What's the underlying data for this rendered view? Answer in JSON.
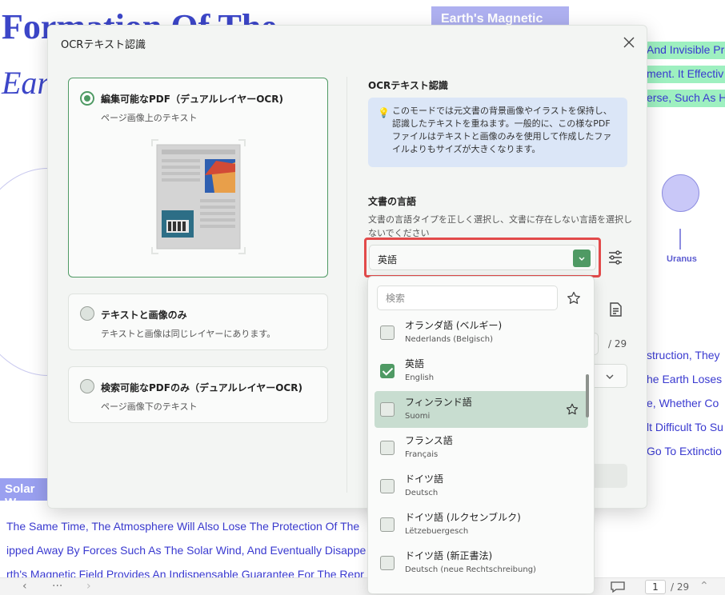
{
  "background": {
    "title_line1": "Formation Of The",
    "title_line2": "Earth",
    "tag": "Earth's Magnetic",
    "highlight_lines": [
      "And Invisible Pro",
      "ment. It Effectiv",
      "erse, Such As H"
    ],
    "right_lines": [
      "struction, They",
      "he Earth Loses",
      "e, Whether Co",
      "lt Difficult To Su",
      "Go To Extinctio"
    ],
    "planet_label": "Uranus",
    "solar_tag": "Solar W",
    "bottom_lines": [
      "The Same Time, The Atmosphere Will Also Lose The Protection Of The",
      "ipped Away By Forces Such As The Solar Wind, And Eventually Disappe",
      "rth's Magnetic Field Provides An Indispensable Guarantee For The Repr"
    ],
    "page_current": "1",
    "page_total": "/ 29"
  },
  "dialog": {
    "title": "OCRテキスト認識",
    "options": [
      {
        "title": "編集可能なPDF（デュアルレイヤーOCR)",
        "subtitle": "ページ画像上のテキスト",
        "selected": true
      },
      {
        "title": "テキストと画像のみ",
        "subtitle": "テキストと画像は同じレイヤーにあります。",
        "selected": false
      },
      {
        "title": "検索可能なPDFのみ（デュアルレイヤーOCR)",
        "subtitle": "ページ画像下のテキスト",
        "selected": false
      }
    ],
    "section_title": "OCRテキスト認識",
    "info_text": "このモードでは元文書の背景画像やイラストを保持し、認識したテキストを重ねます。一般的に、この様なPDFファイルはテキストと画像のみを使用して作成したファイルよりもサイズが大きくなります。",
    "language_heading": "文書の言語",
    "language_desc": "文書の言語タイプを正しく選択し、文書に存在しない言語を選択しないでください",
    "selected_language": "英語",
    "page_total": "/ 29"
  },
  "dropdown": {
    "search_placeholder": "検索",
    "items": [
      {
        "name": "オランダ語 (ベルギー)",
        "native": "Nederlands (Belgisch)",
        "checked": false,
        "hover": false
      },
      {
        "name": "英語",
        "native": "English",
        "checked": true,
        "hover": false
      },
      {
        "name": "フィンランド語",
        "native": "Suomi",
        "checked": false,
        "hover": true
      },
      {
        "name": "フランス語",
        "native": "Français",
        "checked": false,
        "hover": false
      },
      {
        "name": "ドイツ語",
        "native": "Deutsch",
        "checked": false,
        "hover": false
      },
      {
        "name": "ドイツ語 (ルクセンブルク)",
        "native": "Lëtzebuergesch",
        "checked": false,
        "hover": false
      },
      {
        "name": "ドイツ語 (新正書法)",
        "native": "Deutsch (neue Rechtschreibung)",
        "checked": false,
        "hover": false
      }
    ]
  },
  "colors": {
    "accent": "#4f9a64",
    "highlight_box": "#e24a4a",
    "info_bg": "#dbe6f7"
  }
}
